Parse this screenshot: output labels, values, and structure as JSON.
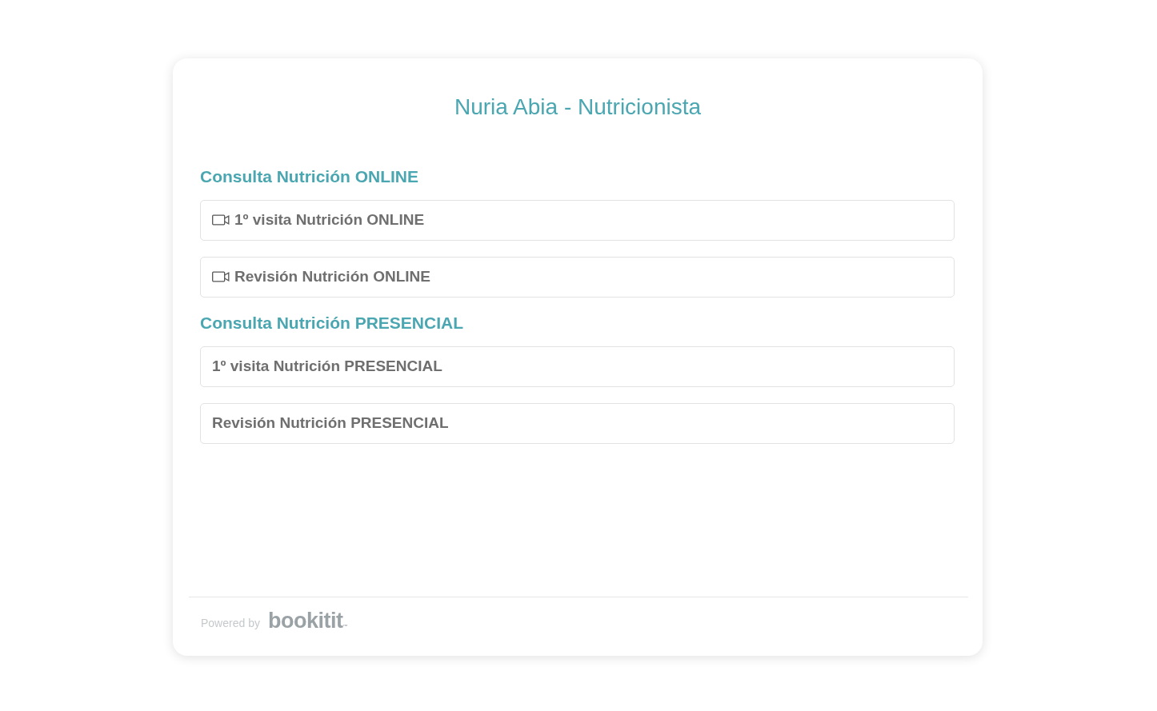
{
  "title": "Nuria Abia - Nutricionista",
  "sections": [
    {
      "heading": "Consulta Nutrición ONLINE",
      "items": [
        {
          "label": "1º visita Nutrición ONLINE",
          "kind": "video"
        },
        {
          "label": "Revisión Nutrición ONLINE",
          "kind": "video"
        }
      ]
    },
    {
      "heading": "Consulta Nutrición PRESENCIAL",
      "items": [
        {
          "label": "1º visita Nutrición PRESENCIAL",
          "kind": "plain"
        },
        {
          "label": "Revisión Nutrición PRESENCIAL",
          "kind": "plain"
        }
      ]
    }
  ],
  "footer": {
    "powered_by": "Powered by",
    "logo": "bookitit",
    "logo_mark": "™"
  }
}
